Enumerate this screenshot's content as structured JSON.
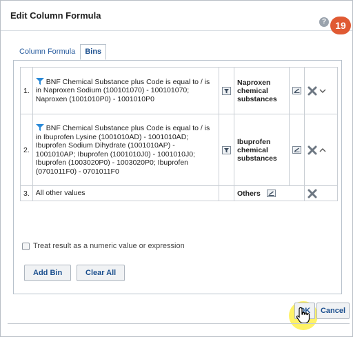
{
  "dialog": {
    "title": "Edit Column Formula",
    "help_glyph": "?",
    "step_badge": "19"
  },
  "tabs": [
    {
      "label": "Column Formula",
      "active": false
    },
    {
      "label": "Bins",
      "active": true
    }
  ],
  "bins": [
    {
      "number": "1.",
      "condition": "BNF Chemical Substance plus Code is equal to / is in  Naproxen Sodium (100101070) - 100101070; Naproxen (1001010P0) - 1001010P0",
      "name_lines": [
        "Naproxen",
        "chemical",
        "substances"
      ],
      "expand_icon": "chevron-down-icon"
    },
    {
      "number": "2.",
      "condition": "BNF Chemical Substance plus Code is equal to / is in  Ibuprofen Lysine (1001010AD) - 1001010AD; Ibuprofen Sodium Dihydrate (1001010AP) - 1001010AP; Ibuprofen (1001010J0) - 1001010J0; Ibuprofen (1003020P0) - 1003020P0; Ibuprofen (0701011F0) - 0701011F0",
      "name_lines": [
        "Ibuprofen",
        "chemical",
        "substances"
      ],
      "expand_icon": "chevron-up-icon"
    },
    {
      "number": "3.",
      "condition": "All other values",
      "name_lines": [
        "Others"
      ],
      "expand_icon": ""
    }
  ],
  "numeric_option": {
    "label": "Treat result as a numeric value or expression",
    "checked": false
  },
  "buttons": {
    "add_bin": "Add Bin",
    "clear_all": "Clear All",
    "ok": "OK",
    "cancel": "Cancel"
  },
  "colors": {
    "accent": "#1b4f8e",
    "filter_icon": "#2b8ad8",
    "badge": "#e05a33",
    "cursor_highlight": "#ffee3c"
  }
}
